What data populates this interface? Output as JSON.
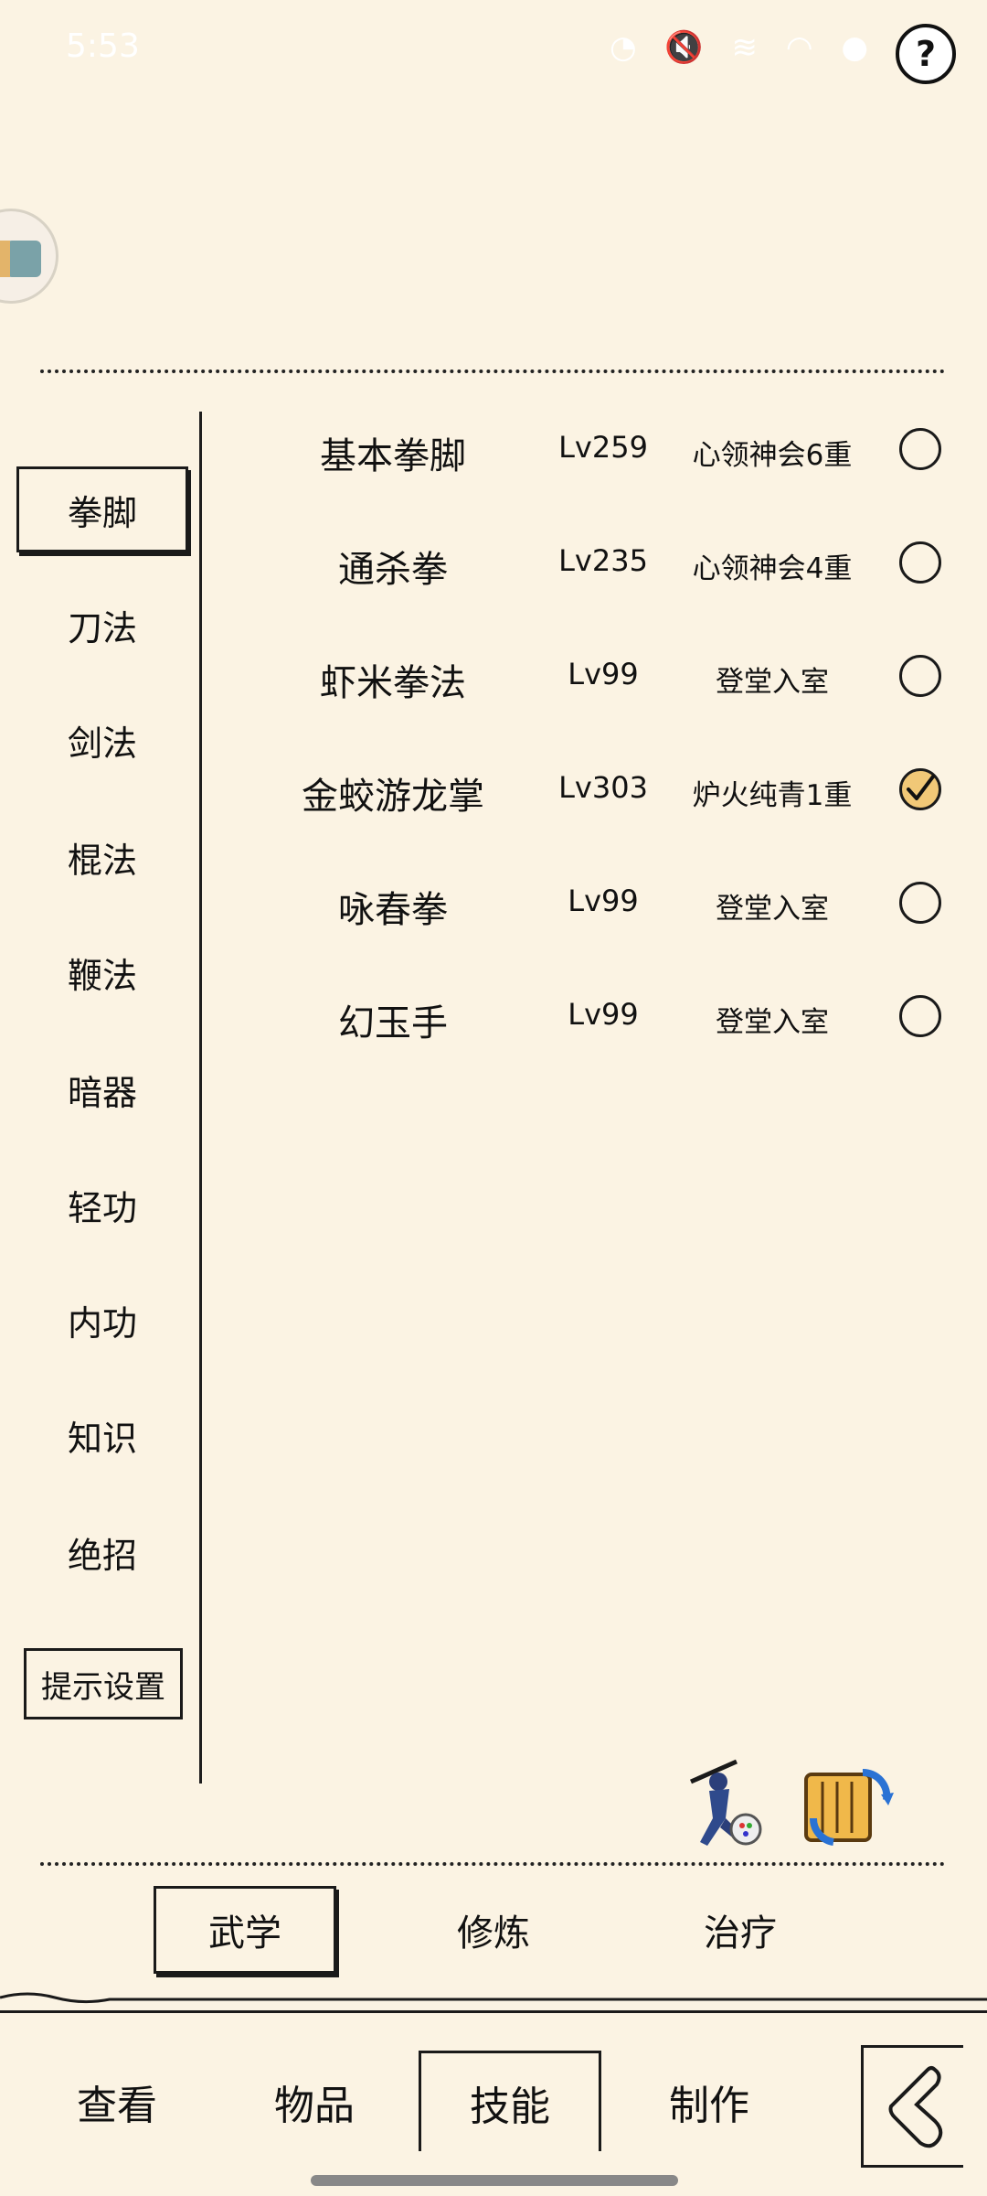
{
  "status": {
    "time": "5:53"
  },
  "categories": [
    {
      "label": "拳脚",
      "active": true
    },
    {
      "label": "刀法",
      "active": false
    },
    {
      "label": "剑法",
      "active": false
    },
    {
      "label": "棍法",
      "active": false
    },
    {
      "label": "鞭法",
      "active": false
    },
    {
      "label": "暗器",
      "active": false
    },
    {
      "label": "轻功",
      "active": false
    },
    {
      "label": "内功",
      "active": false
    },
    {
      "label": "知识",
      "active": false
    },
    {
      "label": "绝招",
      "active": false
    }
  ],
  "settings_button": "提示设置",
  "skills": [
    {
      "name": "基本拳脚",
      "level": "Lv259",
      "stage": "心领神会6重",
      "selected": false
    },
    {
      "name": "通杀拳",
      "level": "Lv235",
      "stage": "心领神会4重",
      "selected": false
    },
    {
      "name": "虾米拳法",
      "level": "Lv99",
      "stage": "登堂入室",
      "selected": false
    },
    {
      "name": "金蛟游龙掌",
      "level": "Lv303",
      "stage": "炉火纯青1重",
      "selected": true
    },
    {
      "name": "咏春拳",
      "level": "Lv99",
      "stage": "登堂入室",
      "selected": false
    },
    {
      "name": "幻玉手",
      "level": "Lv99",
      "stage": "登堂入室",
      "selected": false
    }
  ],
  "tools": [
    {
      "icon": "martial-artist-icon"
    },
    {
      "icon": "scroll-swap-icon"
    }
  ],
  "sub_tabs": [
    {
      "label": "武学",
      "active": true
    },
    {
      "label": "修炼",
      "active": false
    },
    {
      "label": "治疗",
      "active": false
    }
  ],
  "bottom_nav": [
    {
      "label": "查看",
      "active": false
    },
    {
      "label": "物品",
      "active": false
    },
    {
      "label": "技能",
      "active": true
    },
    {
      "label": "制作",
      "active": false
    }
  ],
  "colors": {
    "background": "#fbf3e3",
    "check_fill": "#f1c877",
    "ink": "#1a1a1a"
  }
}
